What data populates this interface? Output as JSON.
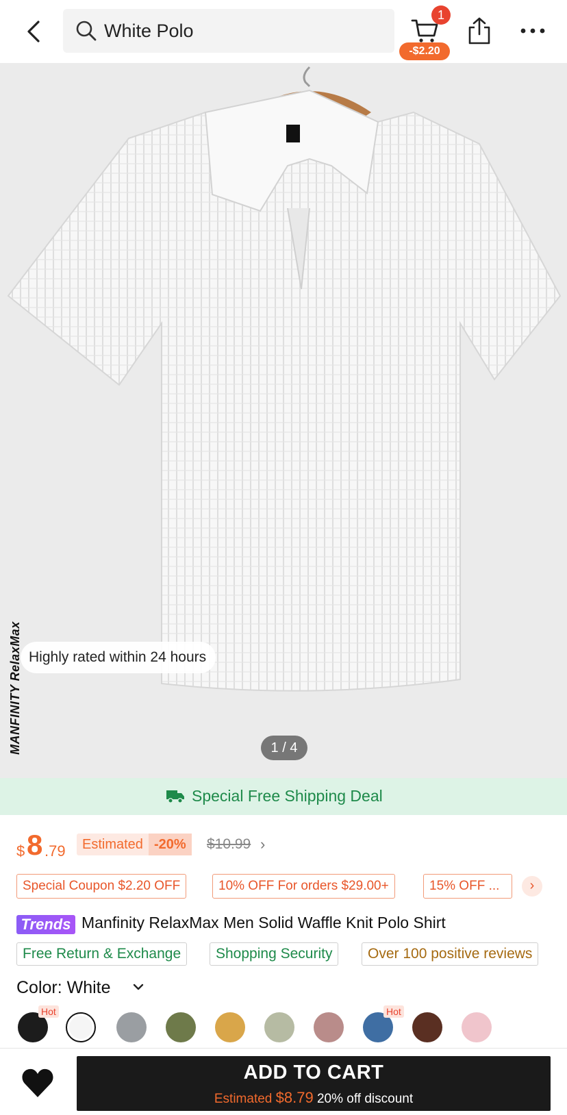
{
  "header": {
    "search_query": "White Polo",
    "cart_count": "1",
    "cart_discount": "-$2.20"
  },
  "gallery": {
    "brand_watermark": "MANFINITY RelaxMax",
    "rating_chip": "Highly rated within 24 hours",
    "page_indicator": "1 / 4"
  },
  "shipping": {
    "label": "Special Free Shipping Deal"
  },
  "price": {
    "currency": "$",
    "main": "8",
    "cents": ".79",
    "estimated_label": "Estimated",
    "estimated_pct": "-20%",
    "original": "$10.99"
  },
  "coupons": [
    "Special Coupon $2.20 OFF",
    "10% OFF For orders $29.00+",
    "15% OFF ..."
  ],
  "product": {
    "badge": "Trends",
    "title": "Manfinity RelaxMax Men Solid Waffle Knit Polo Shirt"
  },
  "features": [
    "Free Return & Exchange",
    "Shopping Security",
    "Over 100 positive reviews"
  ],
  "color": {
    "label": "Color: White",
    "hot_label": "Hot",
    "swatches": [
      "#1c1c1c",
      "#f5f5f5",
      "#9a9ea2",
      "#6e7a4a",
      "#d9a64a",
      "#b6bba3",
      "#b98c8a",
      "#3f6ea3",
      "#5a2f22",
      "#f0c5cc"
    ]
  },
  "bottom_bar": {
    "add_to_cart": "ADD TO CART",
    "estimated_label": "Estimated",
    "estimated_price": "$8.79",
    "discount_note": "20% off discount"
  },
  "colors": {
    "accent_orange": "#f26a2d",
    "cart_badge_red": "#e8432f",
    "shipping_green": "#1e8a4a",
    "shipping_bg": "#ddf3e6"
  }
}
